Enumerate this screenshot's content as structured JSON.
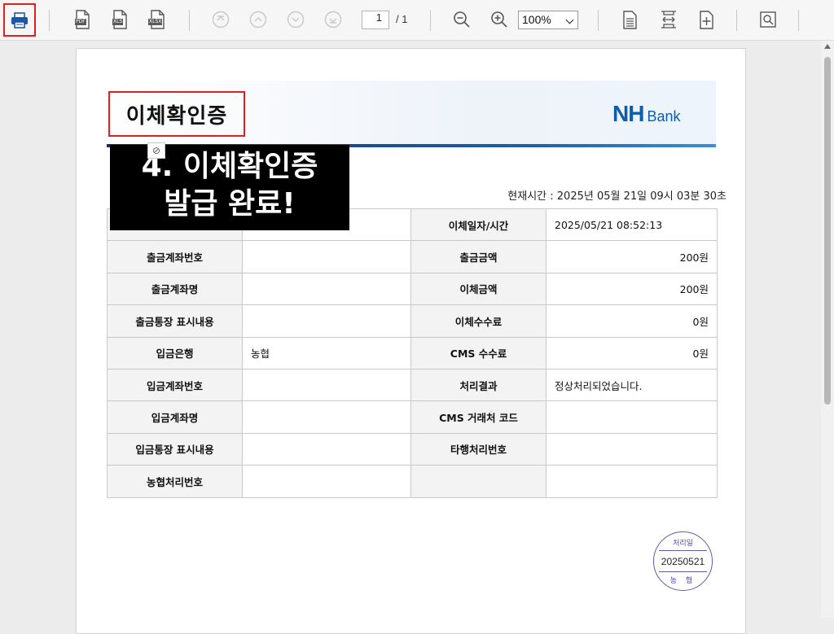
{
  "toolbar": {
    "print_tooltip": "인쇄",
    "file_tags": {
      "pdf": "PDF",
      "xls": "XLS",
      "xlsx": "XLSX"
    },
    "page_current": "1",
    "page_total": "/ 1",
    "zoom_value": "100%",
    "icons": [
      "printer-icon",
      "export-pdf-icon",
      "export-xls-icon",
      "export-xlsx-icon",
      "first-page-icon",
      "prev-page-icon",
      "next-page-icon",
      "last-page-icon",
      "zoom-out-icon",
      "zoom-in-icon",
      "fit-page-icon",
      "fit-width-icon",
      "add-page-icon",
      "find-icon"
    ]
  },
  "document": {
    "title": "이체확인증",
    "logo_nh": "NH",
    "logo_bank": "Bank",
    "banner_line1": "4. 이체확인증",
    "banner_line2": "발급 완료!",
    "now_time": "현재시간 : 2025년 05월 21일 09시 03분 30초",
    "rows": [
      {
        "l1": "",
        "v1": "",
        "l2": "이체일자/시간",
        "v2": "2025/05/21 08:52:13",
        "right": false
      },
      {
        "l1": "출금계좌번호",
        "v1": "",
        "l2": "출금금액",
        "v2": "200원",
        "right": true
      },
      {
        "l1": "출금계좌명",
        "v1": "",
        "l2": "이체금액",
        "v2": "200원",
        "right": true
      },
      {
        "l1": "출금통장 표시내용",
        "v1": "",
        "l2": "이체수수료",
        "v2": "0원",
        "right": true
      },
      {
        "l1": "입금은행",
        "v1": "농협",
        "l2": "CMS 수수료",
        "v2": "0원",
        "right": true
      },
      {
        "l1": "입금계좌번호",
        "v1": "",
        "l2": "처리결과",
        "v2": "정상처리되었습니다.",
        "right": false
      },
      {
        "l1": "입금계좌명",
        "v1": "",
        "l2": "CMS 거래처 코드",
        "v2": "",
        "right": false
      },
      {
        "l1": "입금통장 표시내용",
        "v1": "",
        "l2": "타행처리번호",
        "v2": "",
        "right": false
      },
      {
        "l1": "농협처리번호",
        "v1": "",
        "l2": "",
        "v2": "",
        "right": false
      }
    ],
    "stamp": {
      "top": "처리일",
      "date": "20250521",
      "bottom": "농 협"
    }
  },
  "colors": {
    "highlight": "#e02020",
    "brand": "#0e5cad",
    "stamp": "#5b5bb0"
  }
}
